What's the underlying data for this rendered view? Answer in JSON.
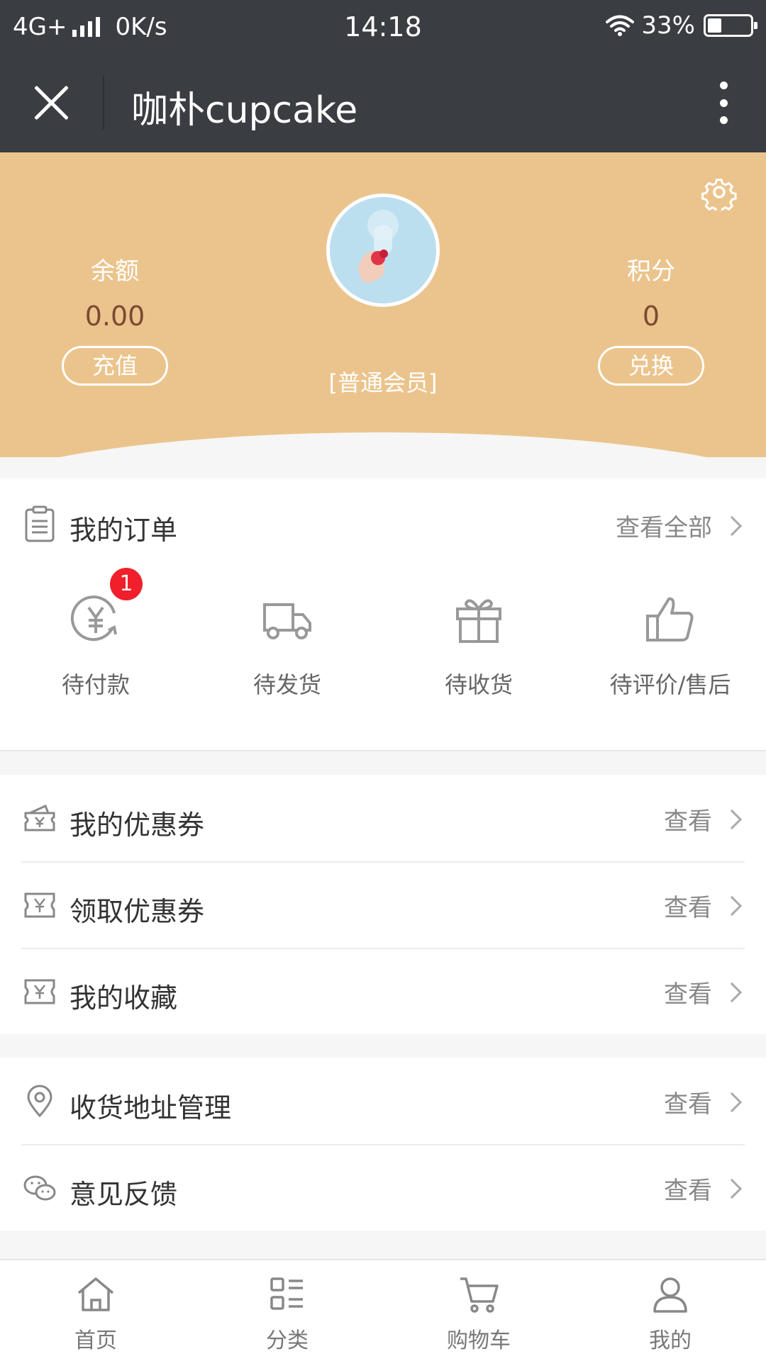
{
  "status_bar": {
    "network": "4G+",
    "speed": "0K/s",
    "time": "14:18",
    "battery": "33%",
    "battery_level": 0.33
  },
  "header": {
    "title": "咖朴cupcake"
  },
  "member": {
    "balance_label": "余额",
    "balance_value": "0.00",
    "recharge_label": "充值",
    "points_label": "积分",
    "points_value": "0",
    "exchange_label": "兑换",
    "level": "[普通会员]"
  },
  "orders": {
    "title": "我的订单",
    "view_all": "查看全部",
    "items": [
      {
        "label": "待付款",
        "icon": "yuan-refresh-icon",
        "badge": "1"
      },
      {
        "label": "待发货",
        "icon": "truck-icon"
      },
      {
        "label": "待收货",
        "icon": "gift-icon"
      },
      {
        "label": "待评价/售后",
        "icon": "thumbs-up-icon"
      }
    ]
  },
  "list1": [
    {
      "label": "我的优惠券",
      "link": "查看",
      "icon": "coupon-icon"
    },
    {
      "label": "领取优惠券",
      "link": "查看",
      "icon": "ticket-icon"
    },
    {
      "label": "我的收藏",
      "link": "查看",
      "icon": "ticket-icon"
    }
  ],
  "list2": [
    {
      "label": "收货地址管理",
      "link": "查看",
      "icon": "location-pin-icon"
    },
    {
      "label": "意见反馈",
      "link": "查看",
      "icon": "wechat-chat-icon"
    }
  ],
  "tabs": [
    {
      "label": "首页",
      "icon": "home-icon"
    },
    {
      "label": "分类",
      "icon": "category-icon"
    },
    {
      "label": "购物车",
      "icon": "cart-icon"
    },
    {
      "label": "我的",
      "icon": "user-icon"
    }
  ],
  "colors": {
    "header_bg": "#3a3d42",
    "card_bg": "#ebc48d",
    "badge": "#f01f2b"
  }
}
